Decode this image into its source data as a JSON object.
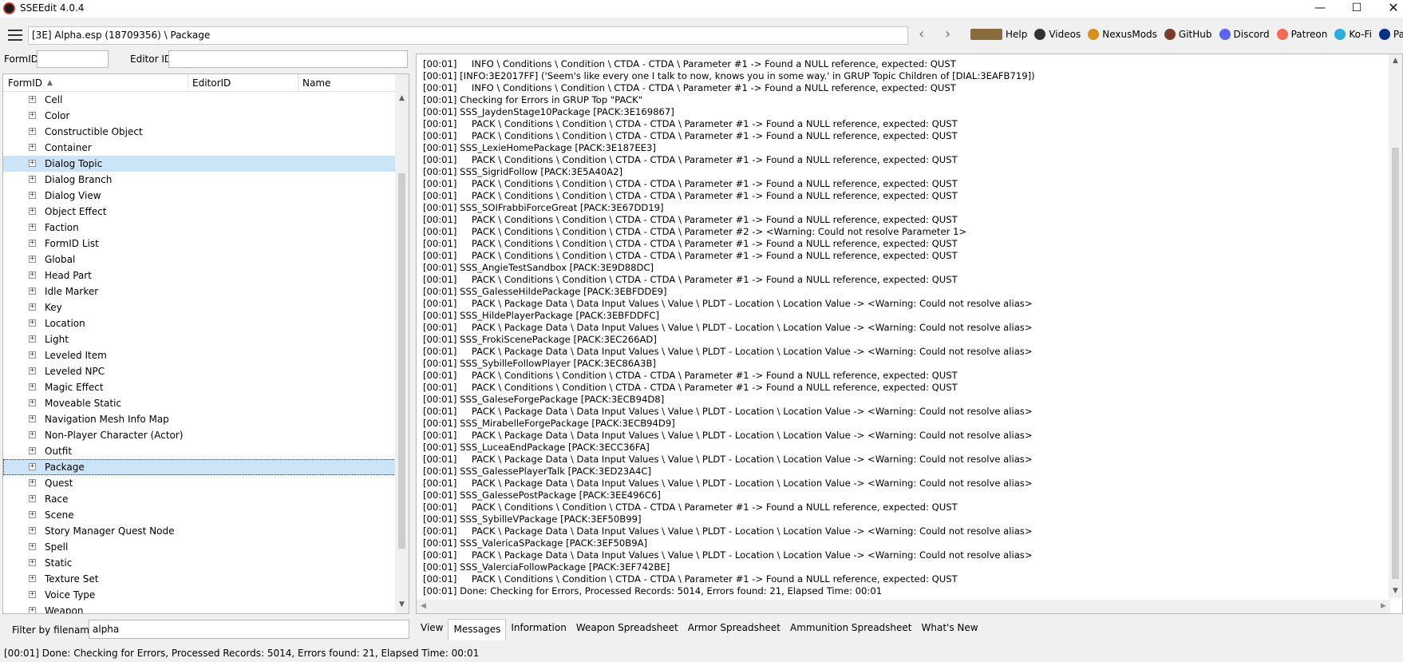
{
  "window": {
    "title": "SSEEdit 4.0.4",
    "minimize": "—",
    "maximize": "☐",
    "close": "✕"
  },
  "toolbar": {
    "path": "[3E] Alpha.esp (18709356) \\ Package",
    "back": "‹",
    "forward": "›",
    "links": [
      {
        "label": "Help",
        "icon": "book-icon",
        "color": "#8a6b3d"
      },
      {
        "label": "Videos",
        "icon": "videos-icon",
        "color": "#333333"
      },
      {
        "label": "NexusMods",
        "icon": "nexusmods-icon",
        "color": "#d98f1c"
      },
      {
        "label": "GitHub",
        "icon": "github-icon",
        "color": "#7a3b2e"
      },
      {
        "label": "Discord",
        "icon": "discord-icon",
        "color": "#5865f2"
      },
      {
        "label": "Patreon",
        "icon": "patreon-icon",
        "color": "#f96854"
      },
      {
        "label": "Ko-Fi",
        "icon": "kofi-icon",
        "color": "#29abe0"
      },
      {
        "label": "PayPa",
        "icon": "paypal-icon",
        "color": "#003087"
      }
    ]
  },
  "search": {
    "formid_label": "FormID",
    "editorid_label": "Editor ID",
    "formid_value": "",
    "editorid_value": ""
  },
  "tree": {
    "columns": [
      "FormID",
      "EditorID",
      "Name"
    ],
    "sort_indicator": "▲",
    "items": [
      {
        "label": "Cell",
        "state": ""
      },
      {
        "label": "Color",
        "state": ""
      },
      {
        "label": "Constructible Object",
        "state": ""
      },
      {
        "label": "Container",
        "state": ""
      },
      {
        "label": "Dialog Topic",
        "state": "sel"
      },
      {
        "label": "Dialog Branch",
        "state": ""
      },
      {
        "label": "Dialog View",
        "state": ""
      },
      {
        "label": "Object Effect",
        "state": ""
      },
      {
        "label": "Faction",
        "state": ""
      },
      {
        "label": "FormID List",
        "state": ""
      },
      {
        "label": "Global",
        "state": ""
      },
      {
        "label": "Head Part",
        "state": ""
      },
      {
        "label": "Idle Marker",
        "state": ""
      },
      {
        "label": "Key",
        "state": ""
      },
      {
        "label": "Location",
        "state": ""
      },
      {
        "label": "Light",
        "state": ""
      },
      {
        "label": "Leveled Item",
        "state": ""
      },
      {
        "label": "Leveled NPC",
        "state": ""
      },
      {
        "label": "Magic Effect",
        "state": ""
      },
      {
        "label": "Moveable Static",
        "state": ""
      },
      {
        "label": "Navigation Mesh Info Map",
        "state": ""
      },
      {
        "label": "Non-Player Character (Actor)",
        "state": ""
      },
      {
        "label": "Outfit",
        "state": ""
      },
      {
        "label": "Package",
        "state": "sel focus"
      },
      {
        "label": "Quest",
        "state": ""
      },
      {
        "label": "Race",
        "state": ""
      },
      {
        "label": "Scene",
        "state": ""
      },
      {
        "label": "Story Manager Quest Node",
        "state": ""
      },
      {
        "label": "Spell",
        "state": ""
      },
      {
        "label": "Static",
        "state": ""
      },
      {
        "label": "Texture Set",
        "state": ""
      },
      {
        "label": "Voice Type",
        "state": ""
      },
      {
        "label": "Weapon",
        "state": ""
      }
    ]
  },
  "filter": {
    "label": "Filter by filename:",
    "value": "alpha"
  },
  "messages": [
    "[00:01]     INFO \\ Conditions \\ Condition \\ CTDA - CTDA \\ Parameter #1 -> Found a NULL reference, expected: QUST",
    "[00:01] [INFO:3E2017FF] ('Seem's like every one I talk to now, knows you in some way.' in GRUP Topic Children of [DIAL:3EAFB719])",
    "[00:01]     INFO \\ Conditions \\ Condition \\ CTDA - CTDA \\ Parameter #1 -> Found a NULL reference, expected: QUST",
    "[00:01] Checking for Errors in GRUP Top \"PACK\"",
    "[00:01] SSS_JaydenStage10Package [PACK:3E169867]",
    "[00:01]     PACK \\ Conditions \\ Condition \\ CTDA - CTDA \\ Parameter #1 -> Found a NULL reference, expected: QUST",
    "[00:01]     PACK \\ Conditions \\ Condition \\ CTDA - CTDA \\ Parameter #1 -> Found a NULL reference, expected: QUST",
    "[00:01] SSS_LexieHomePackage [PACK:3E187EE3]",
    "[00:01]     PACK \\ Conditions \\ Condition \\ CTDA - CTDA \\ Parameter #1 -> Found a NULL reference, expected: QUST",
    "[00:01] SSS_SigridFollow [PACK:3E5A40A2]",
    "[00:01]     PACK \\ Conditions \\ Condition \\ CTDA - CTDA \\ Parameter #1 -> Found a NULL reference, expected: QUST",
    "[00:01]     PACK \\ Conditions \\ Condition \\ CTDA - CTDA \\ Parameter #1 -> Found a NULL reference, expected: QUST",
    "[00:01] SSS_SOIFrabbiForceGreat [PACK:3E67DD19]",
    "[00:01]     PACK \\ Conditions \\ Condition \\ CTDA - CTDA \\ Parameter #1 -> Found a NULL reference, expected: QUST",
    "[00:01]     PACK \\ Conditions \\ Condition \\ CTDA - CTDA \\ Parameter #2 -> <Warning: Could not resolve Parameter 1>",
    "[00:01]     PACK \\ Conditions \\ Condition \\ CTDA - CTDA \\ Parameter #1 -> Found a NULL reference, expected: QUST",
    "[00:01]     PACK \\ Conditions \\ Condition \\ CTDA - CTDA \\ Parameter #1 -> Found a NULL reference, expected: QUST",
    "[00:01] SSS_AngieTestSandbox [PACK:3E9D88DC]",
    "[00:01]     PACK \\ Conditions \\ Condition \\ CTDA - CTDA \\ Parameter #1 -> Found a NULL reference, expected: QUST",
    "[00:01] SSS_GalesseHildePackage [PACK:3EBFDDE9]",
    "[00:01]     PACK \\ Package Data \\ Data Input Values \\ Value \\ PLDT - Location \\ Location Value -> <Warning: Could not resolve alias>",
    "[00:01] SSS_HildePlayerPackage [PACK:3EBFDDFC]",
    "[00:01]     PACK \\ Package Data \\ Data Input Values \\ Value \\ PLDT - Location \\ Location Value -> <Warning: Could not resolve alias>",
    "[00:01] SSS_FrokiScenePackage [PACK:3EC266AD]",
    "[00:01]     PACK \\ Package Data \\ Data Input Values \\ Value \\ PLDT - Location \\ Location Value -> <Warning: Could not resolve alias>",
    "[00:01] SSS_SybilleFollowPlayer [PACK:3EC86A3B]",
    "[00:01]     PACK \\ Conditions \\ Condition \\ CTDA - CTDA \\ Parameter #1 -> Found a NULL reference, expected: QUST",
    "[00:01]     PACK \\ Conditions \\ Condition \\ CTDA - CTDA \\ Parameter #1 -> Found a NULL reference, expected: QUST",
    "[00:01] SSS_GaleseForgePackage [PACK:3ECB94D8]",
    "[00:01]     PACK \\ Package Data \\ Data Input Values \\ Value \\ PLDT - Location \\ Location Value -> <Warning: Could not resolve alias>",
    "[00:01] SSS_MirabelleForgePackage [PACK:3ECB94D9]",
    "[00:01]     PACK \\ Package Data \\ Data Input Values \\ Value \\ PLDT - Location \\ Location Value -> <Warning: Could not resolve alias>",
    "[00:01] SSS_LuceaEndPackage [PACK:3ECC36FA]",
    "[00:01]     PACK \\ Package Data \\ Data Input Values \\ Value \\ PLDT - Location \\ Location Value -> <Warning: Could not resolve alias>",
    "[00:01] SSS_GalessePlayerTalk [PACK:3ED23A4C]",
    "[00:01]     PACK \\ Package Data \\ Data Input Values \\ Value \\ PLDT - Location \\ Location Value -> <Warning: Could not resolve alias>",
    "[00:01] SSS_GalessePostPackage [PACK:3EE496C6]",
    "[00:01]     PACK \\ Conditions \\ Condition \\ CTDA - CTDA \\ Parameter #1 -> Found a NULL reference, expected: QUST",
    "[00:01] SSS_SybilleVPackage [PACK:3EF50B99]",
    "[00:01]     PACK \\ Package Data \\ Data Input Values \\ Value \\ PLDT - Location \\ Location Value -> <Warning: Could not resolve alias>",
    "[00:01] SSS_ValericaSPackage [PACK:3EF50B9A]",
    "[00:01]     PACK \\ Package Data \\ Data Input Values \\ Value \\ PLDT - Location \\ Location Value -> <Warning: Could not resolve alias>",
    "[00:01] SSS_ValerciaFollowPackage [PACK:3EF742BE]",
    "[00:01]     PACK \\ Conditions \\ Condition \\ CTDA - CTDA \\ Parameter #1 -> Found a NULL reference, expected: QUST",
    "[00:01] Done: Checking for Errors, Processed Records: 5014, Errors found: 21, Elapsed Time: 00:01"
  ],
  "tabs": [
    {
      "label": "View",
      "active": false
    },
    {
      "label": "Messages",
      "active": true
    },
    {
      "label": "Information",
      "active": false
    },
    {
      "label": "Weapon Spreadsheet",
      "active": false
    },
    {
      "label": "Armor Spreadsheet",
      "active": false
    },
    {
      "label": "Ammunition Spreadsheet",
      "active": false
    },
    {
      "label": "What's New",
      "active": false
    }
  ],
  "statusbar": {
    "text": "[00:01] Done: Checking for Errors, Processed Records: 5014, Errors found: 21, Elapsed Time: 00:01"
  },
  "scroll_arrows": {
    "up": "▲",
    "down": "▼",
    "left": "◀",
    "right": "▶"
  },
  "expander_glyph": "+"
}
